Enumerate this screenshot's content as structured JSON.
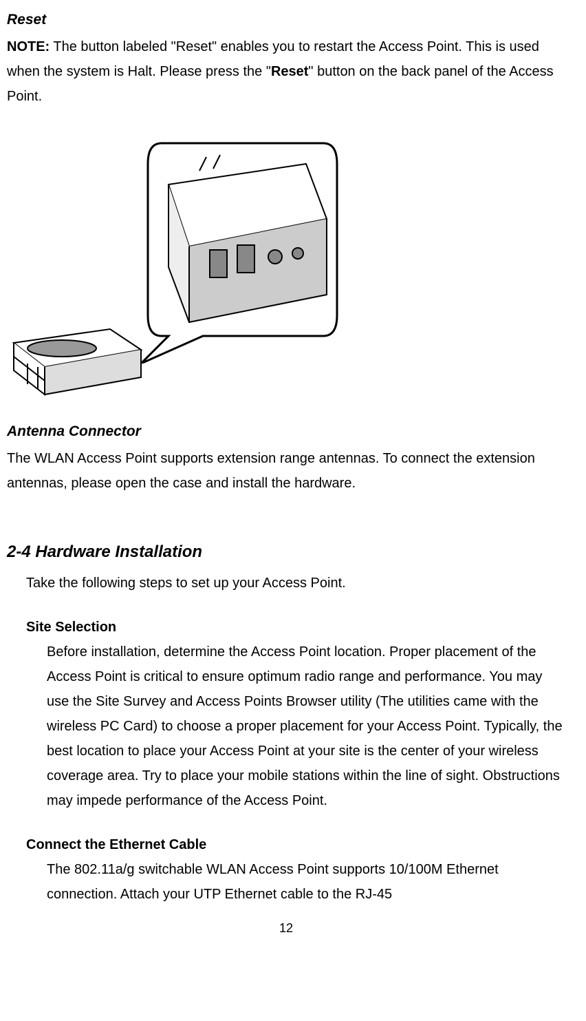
{
  "reset": {
    "heading": "Reset",
    "note_label": "NOTE:",
    "note_text_1": " The button labeled \"Reset\" enables you to restart the Access Point. This is used when the system is Halt. Please press the \"",
    "note_bold": "Reset",
    "note_text_2": "\" button on the back panel of the Access Point."
  },
  "antenna": {
    "heading": "Antenna Connector",
    "text": "The WLAN Access Point supports extension range antennas. To connect the extension antennas, please open the case and install the hardware."
  },
  "hardware": {
    "heading": "2-4 Hardware Installation",
    "intro": "Take the following steps to set up your Access Point.",
    "site_selection": {
      "heading": "Site Selection",
      "text": "Before installation, determine the Access Point location. Proper placement of the Access Point is critical to ensure optimum radio range and performance. You may use the Site Survey and Access Points Browser utility (The utilities came with the wireless PC Card) to choose a proper placement for your Access Point. Typically, the best location to place your Access Point at your site is the center of your wireless coverage area. Try to place your mobile stations within the line of sight. Obstructions may impede performance of the Access Point."
    },
    "ethernet": {
      "heading": "Connect the Ethernet Cable",
      "text": "The 802.11a/g switchable WLAN Access Point supports 10/100M Ethernet connection. Attach your UTP Ethernet cable to the RJ-45"
    }
  },
  "page_number": "12"
}
